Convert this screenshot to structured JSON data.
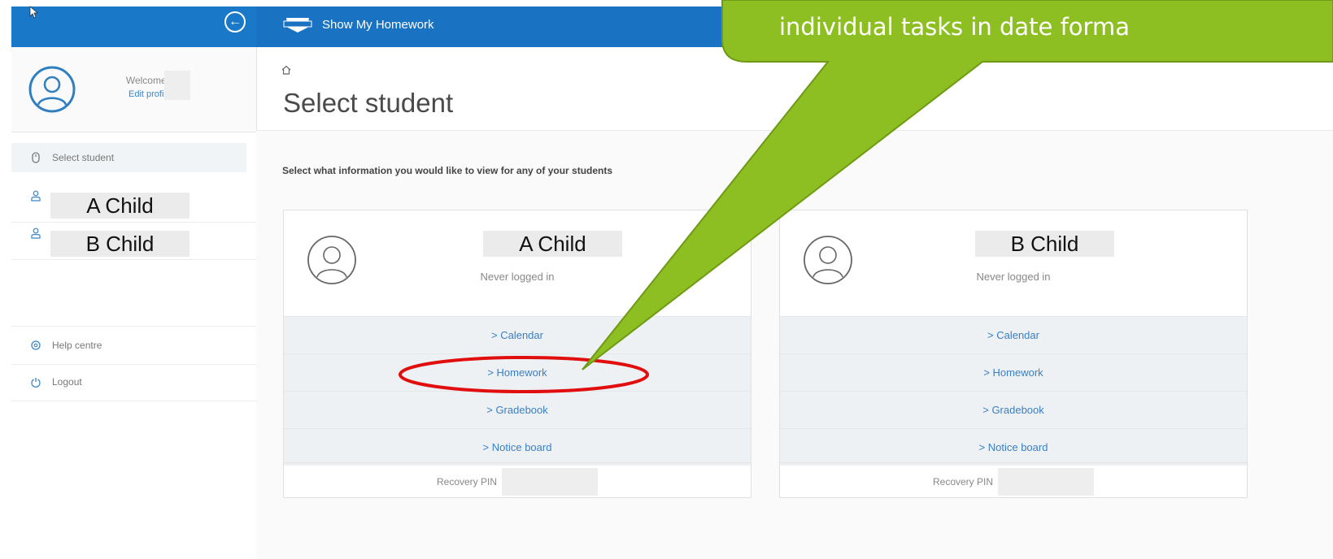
{
  "app": {
    "title": "Show My Homework"
  },
  "sidebar": {
    "welcome": "Welcome,",
    "edit_profile": "Edit profile",
    "select_student": "Select student",
    "children": [
      {
        "label": "A Child"
      },
      {
        "label": "B Child"
      }
    ],
    "help": "Help centre",
    "logout": "Logout"
  },
  "main": {
    "page_title": "Select student",
    "intro": "Select what information you would like to view for any of your students"
  },
  "cards": [
    {
      "name": "A Child",
      "status": "Never logged in",
      "links": [
        "> Calendar",
        "> Homework",
        "> Gradebook",
        "> Notice board"
      ],
      "pin_label": "Recovery PIN"
    },
    {
      "name": "B Child",
      "status": "Never logged in",
      "links": [
        "> Calendar",
        "> Homework",
        "> Gradebook",
        "> Notice board"
      ],
      "pin_label": "Recovery PIN"
    }
  ],
  "callout": {
    "text": "individual tasks in date forma",
    "color": "#8dbf22"
  },
  "colors": {
    "topbar": "#1a72c2",
    "link": "#3a7fc4",
    "highlight": "#e10e0e"
  },
  "icons": {
    "back": "arrow-left-icon",
    "home": "home-icon",
    "avatar": "user-circle-icon",
    "select": "mouse-icon",
    "user": "user-icon",
    "help": "help-icon",
    "logout": "power-icon"
  }
}
